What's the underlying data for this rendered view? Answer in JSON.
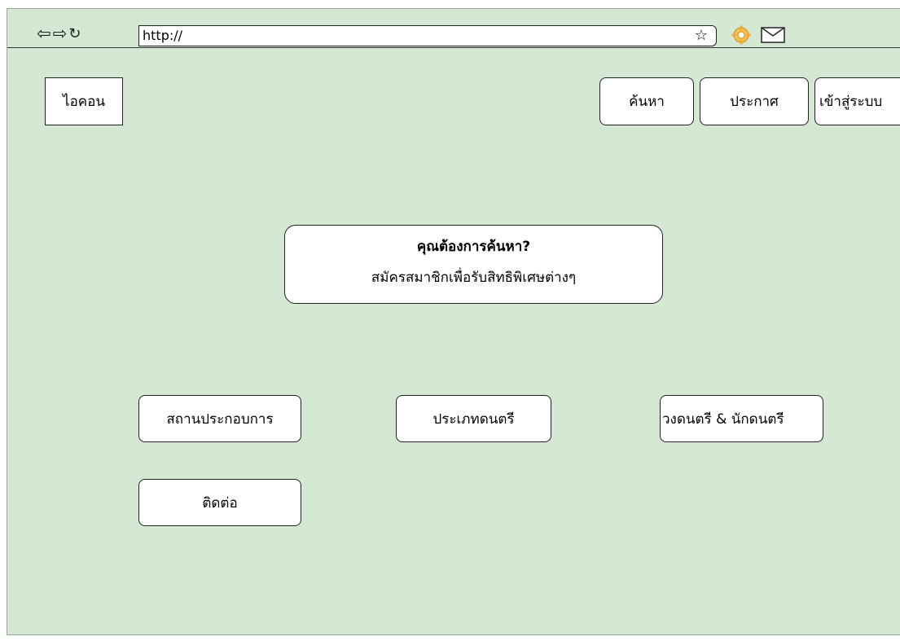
{
  "browser": {
    "back_icon": "back-arrow-icon",
    "forward_icon": "forward-arrow-icon",
    "reload_icon": "reload-icon",
    "url": "http://",
    "bookmark_icon": "star-icon",
    "settings_icon": "gear-icon",
    "mail_icon": "mail-icon"
  },
  "header": {
    "logo_label": "ไอคอน",
    "nav": {
      "search_label": "ค้นหา",
      "announce_label": "ประกาศ",
      "login_label": "เข้าสู่ระบบ"
    }
  },
  "callout": {
    "title": "คุณต้องการค้นหา?",
    "subtitle": "สมัครสมาชิกเพื่อรับสิทธิพิเศษต่างๆ"
  },
  "menu": {
    "venue_label": "สถานประกอบการ",
    "types_label": "ประเภทดนตรี",
    "bands_label": "วงดนตรี & นักดนตรี",
    "contact_label": "ติดต่อ"
  },
  "colors": {
    "canvas_background": "#d5e8d4",
    "box_background": "#ffffff",
    "border": "#222222"
  }
}
